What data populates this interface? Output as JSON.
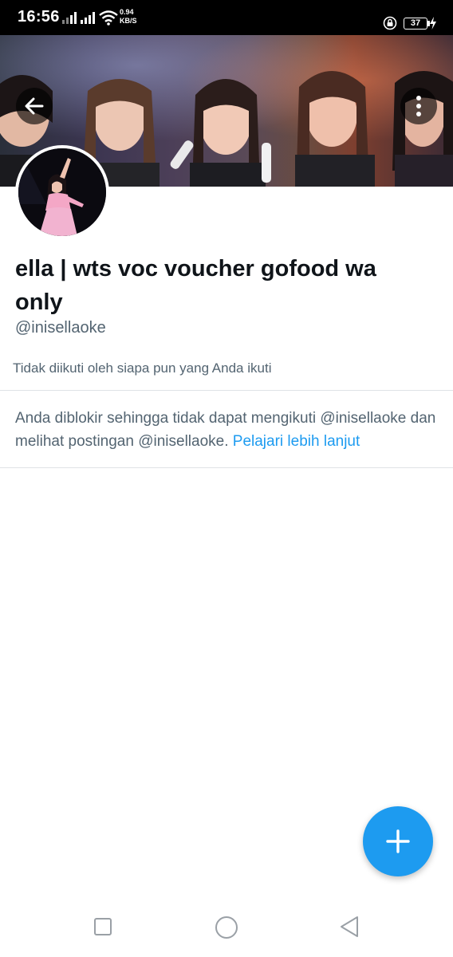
{
  "status_bar": {
    "time": "16:56",
    "net_speed_value": "0.94",
    "net_speed_unit": "KB/S",
    "battery_level": "37",
    "icons": [
      "signal-icon",
      "signal-icon",
      "wifi-icon",
      "rotation-lock-icon",
      "battery-icon",
      "charging-icon"
    ]
  },
  "header": {
    "back_icon": "arrow-left-icon",
    "more_icon": "more-vertical-icon"
  },
  "profile": {
    "display_name": "ella | wts voc voucher gofood wa only",
    "handle": "@inisellaoke",
    "followed_by_text": "Tidak diikuti oleh siapa pun yang Anda ikuti"
  },
  "blocked": {
    "message": "Anda diblokir sehingga tidak dapat mengikuti @inisellaoke dan melihat postingan @inisellaoke.",
    "link_text": "Pelajari lebih lanjut"
  },
  "fab": {
    "icon": "plus-icon"
  },
  "system_nav": {
    "icons": [
      "recents-square-icon",
      "home-circle-icon",
      "back-triangle-icon"
    ]
  },
  "colors": {
    "accent": "#1d9bf0",
    "primary_text": "#0f1419",
    "secondary_text": "#536471",
    "divider": "#dfe3e6"
  }
}
